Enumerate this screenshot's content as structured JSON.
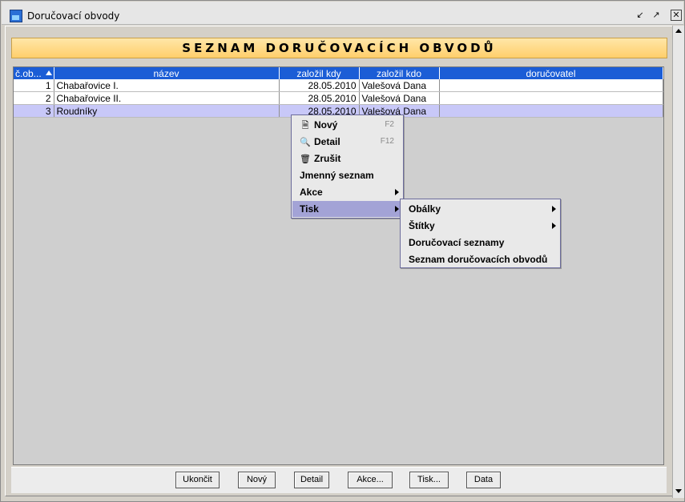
{
  "window": {
    "title": "Doručovací obvody"
  },
  "header": {
    "title": "SEZNAM DORUČOVACÍCH OBVODŮ"
  },
  "table": {
    "columns": [
      "č.ob...",
      "název",
      "založil kdy",
      "založil kdo",
      "doručovatel"
    ],
    "rows": [
      {
        "num": "1",
        "name": "Chabařovice I.",
        "date": "28.05.2010",
        "by": "Valešová Dana",
        "courier": ""
      },
      {
        "num": "2",
        "name": "Chabařovice II.",
        "date": "28.05.2010",
        "by": "Valešová Dana",
        "courier": ""
      },
      {
        "num": "3",
        "name": "Roudníky",
        "date": "28.05.2010",
        "by": "Valešová Dana",
        "courier": ""
      }
    ]
  },
  "context_menu": {
    "new": {
      "label": "Nový",
      "shortcut": "F2",
      "icon": "new-document-icon"
    },
    "detail": {
      "label": "Detail",
      "shortcut": "F12",
      "icon": "magnifier-icon"
    },
    "cancel": {
      "label": "Zrušit",
      "icon": "trash-icon"
    },
    "names_list": {
      "label": "Jmenný seznam"
    },
    "actions": {
      "label": "Akce"
    },
    "print": {
      "label": "Tisk"
    }
  },
  "print_submenu": {
    "envelopes": "Obálky",
    "labels": "Štítky",
    "delivery_lists": "Doručovací seznamy",
    "districts_list": "Seznam doručovacích obvodů"
  },
  "buttons": {
    "close": "Ukončit",
    "new": "Nový",
    "detail": "Detail",
    "actions": "Akce...",
    "print": "Tisk...",
    "data": "Data"
  },
  "colors": {
    "header_band": "#ffcf6b",
    "table_header": "#1b5dd6",
    "selected_row": "#c8c8f8",
    "menu_highlight": "#a3a3d6"
  }
}
